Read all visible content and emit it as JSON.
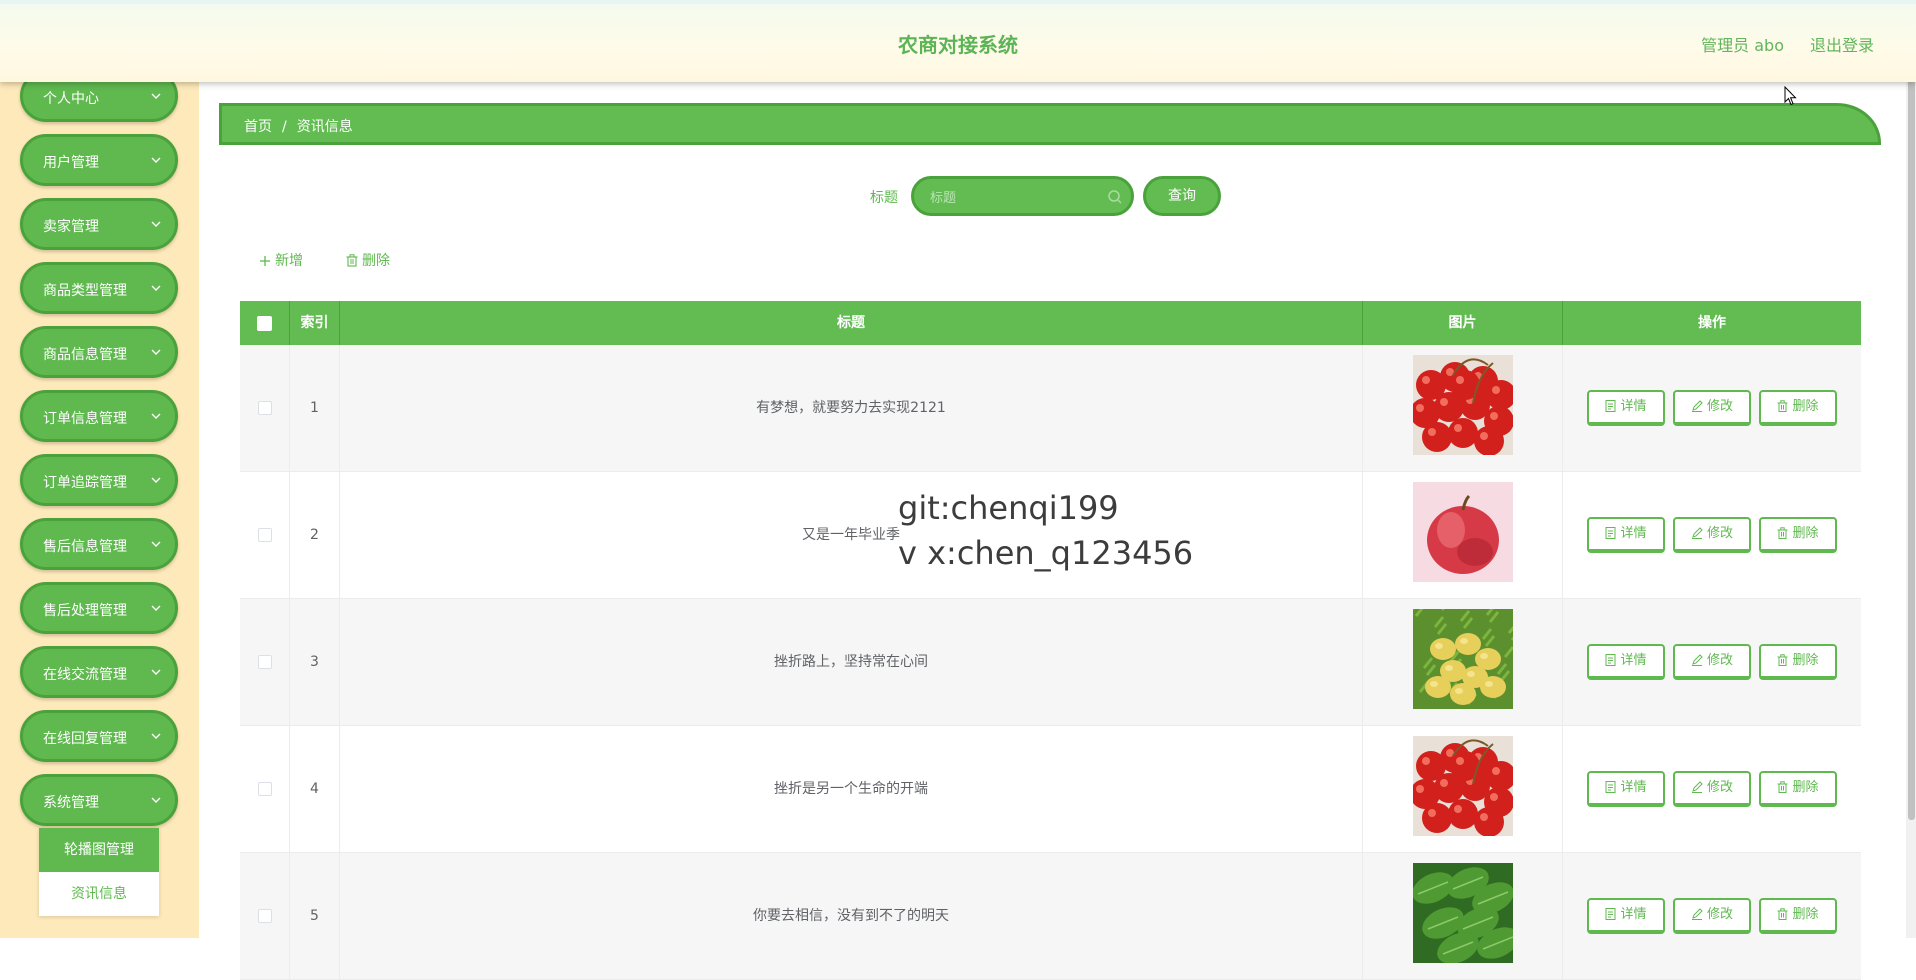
{
  "header": {
    "title": "农商对接系统",
    "user": "管理员 abo",
    "logout": "退出登录"
  },
  "sidebar": {
    "items": [
      {
        "label": "个人中心"
      },
      {
        "label": "用户管理"
      },
      {
        "label": "卖家管理"
      },
      {
        "label": "商品类型管理"
      },
      {
        "label": "商品信息管理"
      },
      {
        "label": "订单信息管理"
      },
      {
        "label": "订单追踪管理"
      },
      {
        "label": "售后信息管理"
      },
      {
        "label": "售后处理管理"
      },
      {
        "label": "在线交流管理"
      },
      {
        "label": "在线回复管理"
      },
      {
        "label": "系统管理"
      }
    ],
    "submenu": [
      {
        "label": "轮播图管理",
        "active": true
      },
      {
        "label": "资讯信息",
        "active": false
      }
    ]
  },
  "breadcrumb": {
    "home": "首页",
    "separator": "/",
    "current": "资讯信息"
  },
  "search": {
    "label": "标题",
    "placeholder": "标题",
    "value": "",
    "button": "查询"
  },
  "toolbar": {
    "add": "新增",
    "delete": "删除"
  },
  "table": {
    "columns": {
      "index": "索引",
      "title": "标题",
      "image": "图片",
      "actions": "操作"
    },
    "action_labels": {
      "detail": "详情",
      "edit": "修改",
      "delete": "删除"
    },
    "rows": [
      {
        "index": "1",
        "title": "有梦想，就要努力去实现2121",
        "image": "cherries-photo"
      },
      {
        "index": "2",
        "title": "又是一年毕业季",
        "image": "apple-photo"
      },
      {
        "index": "3",
        "title": "挫折路上，坚持常在心间",
        "image": "potatoes-photo"
      },
      {
        "index": "4",
        "title": "挫折是另一个生命的开端",
        "image": "cherries-photo"
      },
      {
        "index": "5",
        "title": "你要去相信，没有到不了的明天",
        "image": "greens-photo"
      }
    ]
  },
  "watermark": {
    "line1": "git:chenqi199",
    "line2": "v x:chen_q123456"
  },
  "colors": {
    "primary": "#62bc52",
    "primary_dark": "#4aa23b",
    "sidebar_bg": "#fde9b9",
    "header_bg": "#fffbe9"
  }
}
